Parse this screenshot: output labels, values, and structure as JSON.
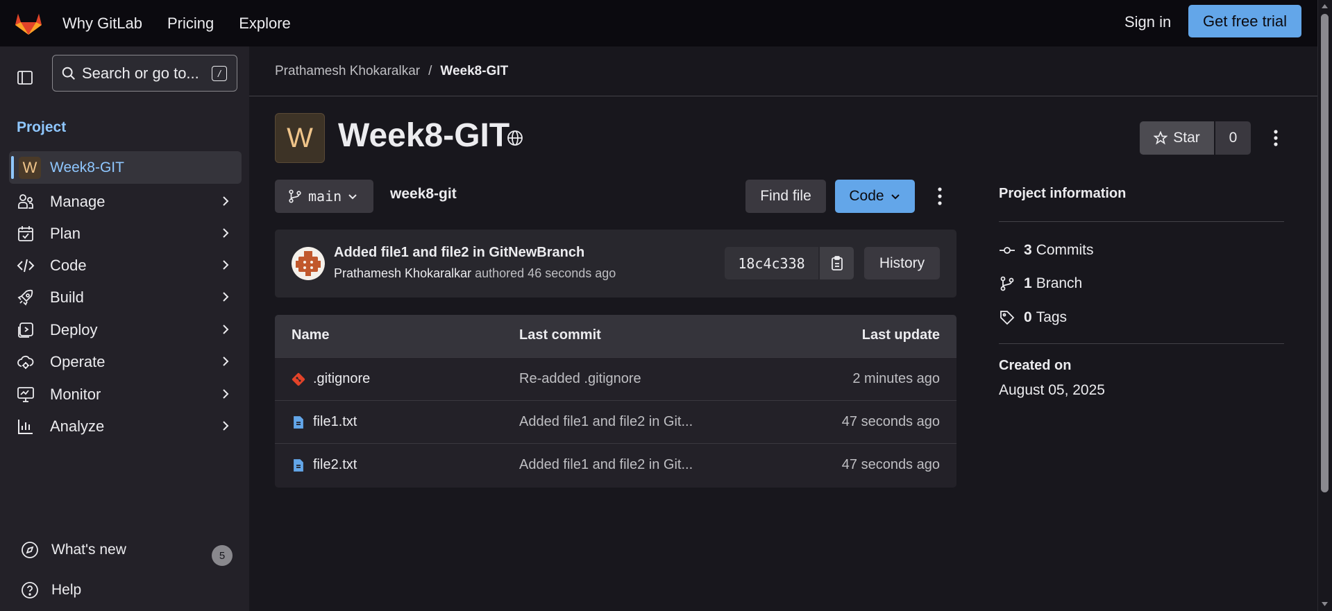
{
  "topbar": {
    "nav": [
      "Why GitLab",
      "Pricing",
      "Explore"
    ],
    "sign_in": "Sign in",
    "trial": "Get free trial"
  },
  "sidebar": {
    "search_placeholder": "Search or go to...",
    "search_shortcut": "/",
    "section": "Project",
    "project_initial": "W",
    "project_name": "Week8-GIT",
    "items": [
      {
        "label": "Manage",
        "icon": "users-icon"
      },
      {
        "label": "Plan",
        "icon": "calendar-icon"
      },
      {
        "label": "Code",
        "icon": "code-icon"
      },
      {
        "label": "Build",
        "icon": "rocket-icon"
      },
      {
        "label": "Deploy",
        "icon": "deploy-icon"
      },
      {
        "label": "Operate",
        "icon": "cloud-icon"
      },
      {
        "label": "Monitor",
        "icon": "monitor-icon"
      },
      {
        "label": "Analyze",
        "icon": "chart-icon"
      }
    ],
    "whats_new": "What's new",
    "whats_new_count": "5",
    "help": "Help"
  },
  "breadcrumb": {
    "owner": "Prathamesh Khokaralkar",
    "separator": "/",
    "project": "Week8-GIT"
  },
  "project": {
    "initial": "W",
    "title": "Week8-GIT",
    "star_label": "Star",
    "star_count": "0"
  },
  "repo": {
    "branch": "main",
    "path": "week8-git",
    "find_file": "Find file",
    "code": "Code"
  },
  "commit": {
    "title": "Added file1 and file2 in GitNewBranch",
    "author": "Prathamesh Khokaralkar",
    "meta": "authored 46 seconds ago",
    "sha": "18c4c338",
    "history": "History"
  },
  "files": {
    "headers": {
      "name": "Name",
      "last_commit": "Last commit",
      "last_update": "Last update"
    },
    "rows": [
      {
        "name": ".gitignore",
        "commit": "Re-added .gitignore",
        "updated": "2 minutes ago",
        "icon": "git-icon"
      },
      {
        "name": "file1.txt",
        "commit": "Added file1 and file2 in Git...",
        "updated": "47 seconds ago",
        "icon": "file-icon"
      },
      {
        "name": "file2.txt",
        "commit": "Added file1 and file2 in Git...",
        "updated": "47 seconds ago",
        "icon": "file-icon"
      }
    ]
  },
  "info": {
    "title": "Project information",
    "commits_count": "3",
    "commits_label": "Commits",
    "branch_count": "1",
    "branch_label": "Branch",
    "tags_count": "0",
    "tags_label": "Tags",
    "created_label": "Created on",
    "created_value": "August 05, 2025"
  },
  "colors": {
    "accent": "#63a6e9",
    "link": "#8fc7ff",
    "background": "#18171d",
    "sidebar": "#232128",
    "git_icon": "#e24329"
  }
}
